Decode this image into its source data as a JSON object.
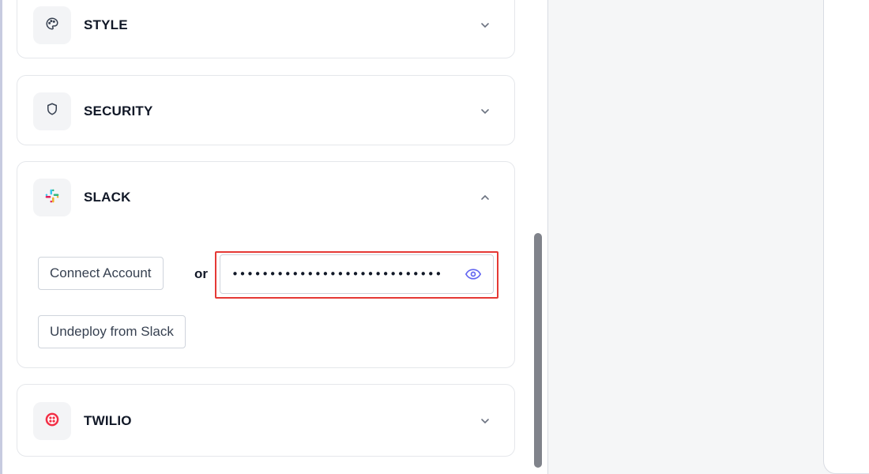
{
  "sections": [
    {
      "id": "style",
      "title": "STYLE",
      "icon": "palette-icon",
      "expanded": false
    },
    {
      "id": "security",
      "title": "SECURITY",
      "icon": "shield-icon",
      "expanded": false
    },
    {
      "id": "slack",
      "title": "SLACK",
      "icon": "slack-logo-icon",
      "expanded": true
    },
    {
      "id": "twilio",
      "title": "TWILIO",
      "icon": "twilio-logo-icon",
      "expanded": false
    }
  ],
  "slack": {
    "connect_label": "Connect Account",
    "or_label": "or",
    "token_value": "••••••••••••••••••••••••••••",
    "undeploy_label": "Undeploy from Slack"
  },
  "colors": {
    "highlight": "#e53935",
    "eye_icon": "#6366f1",
    "twilio_brand": "#f22f46",
    "scrollbar": "#80838b"
  }
}
